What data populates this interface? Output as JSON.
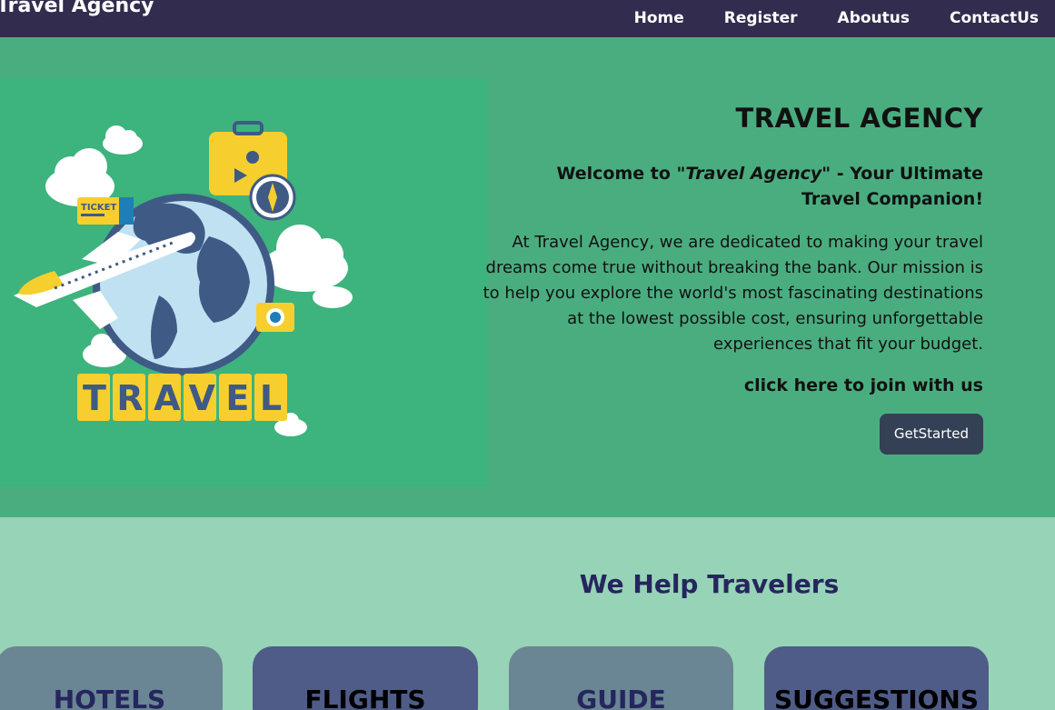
{
  "nav": {
    "brand": "Travel Agency",
    "links": [
      "Home",
      "Register",
      "Aboutus",
      "ContactUs"
    ]
  },
  "hero": {
    "illustration_label": "TRAVEL",
    "ticket_label": "TICKET",
    "title": "TRAVEL AGENCY",
    "welcome_prefix": "Welcome to ",
    "welcome_name": "\"Travel Agency\"",
    "welcome_suffix": " - Your Ultimate Travel Companion!",
    "description": "At Travel Agency, we are dedicated to making your travel dreams come true without breaking the bank. Our mission is to help you explore the world's most fascinating destinations at the lowest possible cost, ensuring unforgettable experiences that fit your budget.",
    "cta_label": "click here to join with us",
    "cta_button": "GetStarted"
  },
  "services": {
    "title": "We Help Travelers",
    "cards": [
      "HOTELS",
      "FLIGHTS",
      "GUIDE",
      "SUGGESTIONS"
    ]
  },
  "colors": {
    "navbar": "#322d4e",
    "hero_bg": "#4aad80",
    "page_bg": "#97d3b6",
    "button": "#344055"
  }
}
